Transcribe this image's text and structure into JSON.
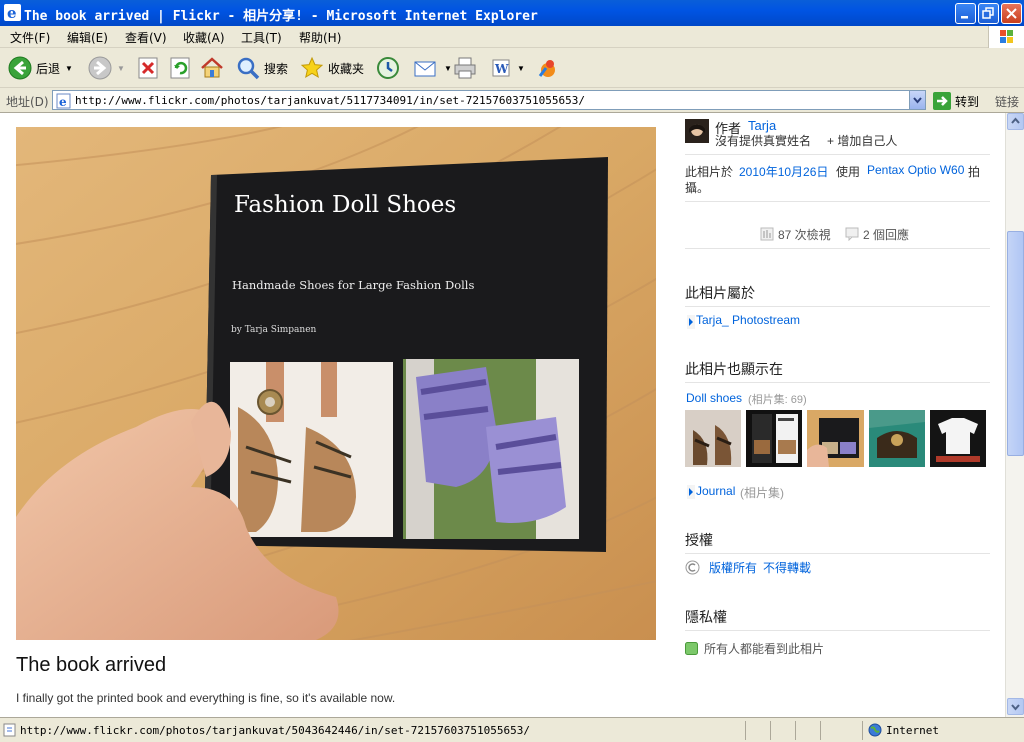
{
  "window": {
    "title": "The book arrived | Flickr - 相片分享! - Microsoft Internet Explorer"
  },
  "menu": [
    "文件(F)",
    "编辑(E)",
    "查看(V)",
    "收藏(A)",
    "工具(T)",
    "帮助(H)"
  ],
  "toolbar": {
    "back": "后退",
    "search": "搜索",
    "favorites": "收藏夹"
  },
  "address": {
    "label": "地址(D)",
    "url": "http://www.flickr.com/photos/tarjankuvat/5117734091/in/set-72157603751055653/",
    "go": "转到",
    "links": "链接"
  },
  "photo": {
    "book_title": "Fashion Doll Shoes",
    "book_subtitle": "Handmade Shoes for Large Fashion Dolls",
    "book_author": "by Tarja Simpanen",
    "title": "The book arrived",
    "description": "I finally got the printed book and everything is fine, so it's available now."
  },
  "sidebar": {
    "author_label": "作者",
    "author_name": "Tarja",
    "no_real_name": "沒有提供真實姓名",
    "add_contact": "+ 增加自己人",
    "taken_prefix": "此相片於",
    "taken_date": "2010年10月26日",
    "taken_using": "使用",
    "camera": "Pentax Optio W60",
    "taken_suffix": "拍",
    "taken_suffix2": "攝。",
    "views": "87 次檢視",
    "comments": "2 個回應",
    "belongs_heading": "此相片屬於",
    "photostream": "Tarja_ Photostream",
    "appears_heading": "此相片也顯示在",
    "set1_name": "Doll shoes",
    "set1_meta": "(相片集: 69)",
    "set2_name": "Journal",
    "set2_meta": "(相片集)",
    "license_heading": "授權",
    "license_text": "版權所有",
    "license_text2": "不得轉載",
    "privacy_heading": "隱私權",
    "privacy_text": "所有人都能看到此相片"
  },
  "status": {
    "url": "http://www.flickr.com/photos/tarjankuvat/5043642446/in/set-72157603751055653/",
    "zone": "Internet"
  }
}
